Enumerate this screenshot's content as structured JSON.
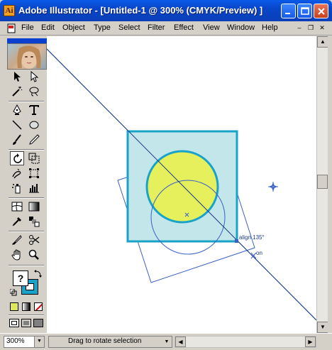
{
  "window": {
    "title": "Adobe Illustrator - [Untitled-1 @ 300% (CMYK/Preview) ]",
    "app_icon": "illustrator-icon"
  },
  "menu": {
    "items": [
      "File",
      "Edit",
      "Object",
      "Type",
      "Select",
      "Filter",
      "Effect",
      "View",
      "Window",
      "Help"
    ],
    "mdi_controls": [
      "minimize-doc",
      "restore-doc",
      "close-doc"
    ]
  },
  "toolbox": {
    "tools": [
      "selection-tool",
      "direct-selection-tool",
      "magic-wand-tool",
      "lasso-tool",
      "pen-tool",
      "type-tool",
      "line-segment-tool",
      "ellipse-tool",
      "paintbrush-tool",
      "pencil-tool",
      "rotate-tool",
      "scale-tool",
      "warp-tool",
      "free-transform-tool",
      "symbol-sprayer-tool",
      "column-graph-tool",
      "mesh-tool",
      "gradient-tool",
      "eyedropper-tool",
      "blend-tool",
      "slice-tool",
      "scissors-tool",
      "hand-tool",
      "zoom-tool"
    ],
    "active_tool": "rotate-tool",
    "fill_stroke_label": "?",
    "fill_color": "#ffffff",
    "stroke_color": "#1aa3c8"
  },
  "canvas": {
    "square_fill": "#c3e6ea",
    "square_stroke": "#1aa3c8",
    "circle_fill": "#e6ef5c",
    "circle_stroke": "#1aa3c8",
    "guide_color": "#3a60c8",
    "smart_guide_label_1": "align 135°",
    "smart_guide_label_2": "on"
  },
  "statusbar": {
    "zoom": "300%",
    "status_text": "Drag to rotate selection"
  }
}
